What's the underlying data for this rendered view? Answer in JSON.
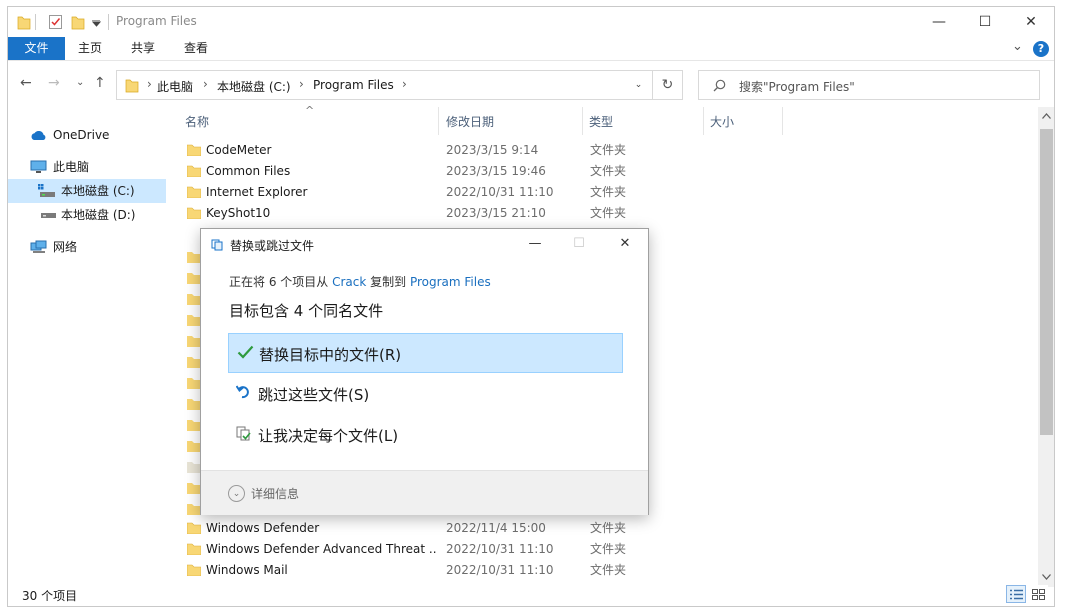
{
  "window": {
    "title": "Program Files",
    "minimize_glyph": "—",
    "maximize_glyph": "☐",
    "close_glyph": "✕"
  },
  "ribbon": {
    "tabs": [
      "文件",
      "主页",
      "共享",
      "查看"
    ],
    "help_glyph": "?",
    "collapse_glyph": "⌄"
  },
  "address": {
    "segments": [
      "此电脑",
      "本地磁盘 (C:)",
      "Program Files"
    ],
    "sep_glyph": "›",
    "back_glyph": "←",
    "forward_glyph": "→",
    "recent_glyph": "⌄",
    "up_glyph": "↑",
    "dropdown_glyph": "⌄",
    "refresh_glyph": "↻"
  },
  "search": {
    "placeholder": "搜索\"Program Files\""
  },
  "nav": {
    "items": [
      {
        "label": "OneDrive",
        "icon": "onedrive-icon"
      },
      {
        "label": "此电脑",
        "icon": "pc-icon"
      },
      {
        "label": "本地磁盘 (C:)",
        "icon": "drive-icon"
      },
      {
        "label": "本地磁盘 (D:)",
        "icon": "drive-icon"
      },
      {
        "label": "网络",
        "icon": "network-icon"
      }
    ]
  },
  "columns": {
    "name": "名称",
    "date": "修改日期",
    "type": "类型",
    "size": "大小",
    "sort_glyph": "^"
  },
  "files": [
    {
      "name": "CodeMeter",
      "date": "2023/3/15 9:14",
      "type": "文件夹"
    },
    {
      "name": "Common Files",
      "date": "2023/3/15 19:46",
      "type": "文件夹"
    },
    {
      "name": "Internet Explorer",
      "date": "2022/10/31 11:10",
      "type": "文件夹"
    },
    {
      "name": "KeyShot10",
      "date": "2023/3/15 21:10",
      "type": "文件夹"
    },
    {
      "name": "Windows Defender",
      "date": "2022/11/4 15:00",
      "type": "文件夹"
    },
    {
      "name": "Windows Defender Advanced Threat ...",
      "date": "2022/10/31 11:10",
      "type": "文件夹"
    },
    {
      "name": "Windows Mail",
      "date": "2022/10/31 11:10",
      "type": "文件夹"
    }
  ],
  "status": {
    "count": "30 个项目"
  },
  "dialog": {
    "title": "替换或跳过文件",
    "line_prefix": "正在将 6 个项目从 ",
    "source": "Crack",
    "line_middle": " 复制到 ",
    "target": "Program Files",
    "heading": "目标包含 4 个同名文件",
    "options": [
      {
        "label": "替换目标中的文件(R)",
        "icon": "check-icon"
      },
      {
        "label": "跳过这些文件(S)",
        "icon": "skip-icon"
      },
      {
        "label": "让我决定每个文件(L)",
        "icon": "decide-icon"
      }
    ],
    "details": "详细信息",
    "minimize_glyph": "—",
    "maximize_glyph": "☐",
    "close_glyph": "✕",
    "chevron_glyph": "⌄"
  },
  "colors": {
    "accent": "#1a73c8",
    "selection": "#cce8ff",
    "folder": "#f8d775",
    "link": "#1a6fbf",
    "check": "#2e9a3e"
  }
}
